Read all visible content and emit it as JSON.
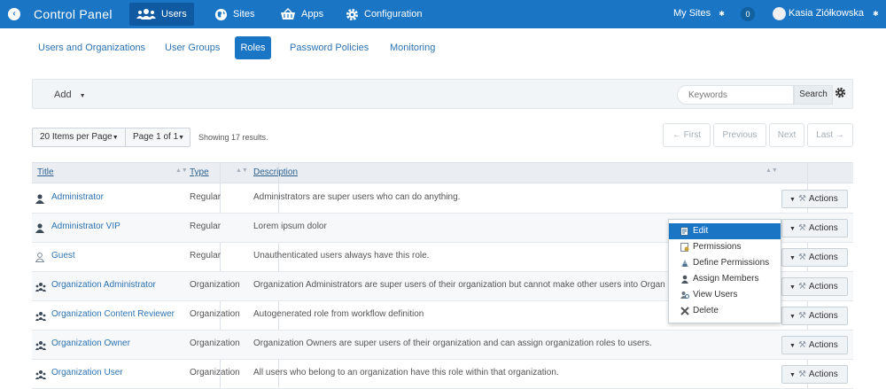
{
  "topbar": {
    "title": "Control Panel",
    "nav": [
      {
        "label": "Users",
        "icon": "users-icon",
        "active": true
      },
      {
        "label": "Sites",
        "icon": "globe-icon",
        "active": false
      },
      {
        "label": "Apps",
        "icon": "basket-icon",
        "active": false
      },
      {
        "label": "Configuration",
        "icon": "gear-icon",
        "active": false
      }
    ],
    "my_sites": "My Sites",
    "notification_count": "0",
    "user_name": "Kasia Ziółkowska"
  },
  "subnav": {
    "items": [
      "Users and Organizations",
      "User Groups",
      "Roles",
      "Password Policies",
      "Monitoring"
    ],
    "active": "Roles"
  },
  "toolbar": {
    "add_label": "Add",
    "search_placeholder": "Keywords",
    "search_label": "Search"
  },
  "pagination": {
    "per_page": "20 Items per Page",
    "page": "Page 1 of 1",
    "showing": "Showing 17 results.",
    "first": "← First",
    "previous": "Previous",
    "next": "Next",
    "last": "Last →"
  },
  "table": {
    "columns": [
      "Title",
      "Type",
      "Description"
    ],
    "rows": [
      {
        "title": "Administrator",
        "type": "Regular",
        "description": "Administrators are super users who can do anything.",
        "icon": "user-icon",
        "action": "Actions"
      },
      {
        "title": "Administrator VIP",
        "type": "Regular",
        "description": "Lorem ipsum dolor",
        "icon": "user-icon",
        "action": "Actions"
      },
      {
        "title": "Guest",
        "type": "Regular",
        "description": "Unauthenticated users always have this role.",
        "icon": "guest-icon",
        "action": "Actions"
      },
      {
        "title": "Organization Administrator",
        "type": "Organization",
        "description": "Organization Administrators are super users of their organization but cannot make other users into Organization Administrators.",
        "icon": "organization-icon",
        "action": "Actions"
      },
      {
        "title": "Organization Content Reviewer",
        "type": "Organization",
        "description": "Autogenerated role from workflow definition",
        "icon": "organization-icon",
        "action": "Actions"
      },
      {
        "title": "Organization Owner",
        "type": "Organization",
        "description": "Organization Owners are super users of their organization and can assign organization roles to users.",
        "icon": "organization-icon",
        "action": "Actions"
      },
      {
        "title": "Organization User",
        "type": "Organization",
        "description": "All users who belong to an organization have this role within that organization.",
        "icon": "organization-icon",
        "action": "Actions"
      }
    ]
  },
  "actions_menu": {
    "items": [
      {
        "label": "Edit",
        "icon": "edit-icon",
        "active": true
      },
      {
        "label": "Permissions",
        "icon": "permissions-icon",
        "active": false
      },
      {
        "label": "Define Permissions",
        "icon": "define-permissions-icon",
        "active": false
      },
      {
        "label": "Assign Members",
        "icon": "assign-members-icon",
        "active": false
      },
      {
        "label": "View Users",
        "icon": "view-users-icon",
        "active": false
      },
      {
        "label": "Delete",
        "icon": "delete-icon",
        "active": false
      }
    ]
  },
  "colors": {
    "primary": "#1a75c4",
    "link": "#2c73b3",
    "header_bg": "#eaeef2"
  }
}
